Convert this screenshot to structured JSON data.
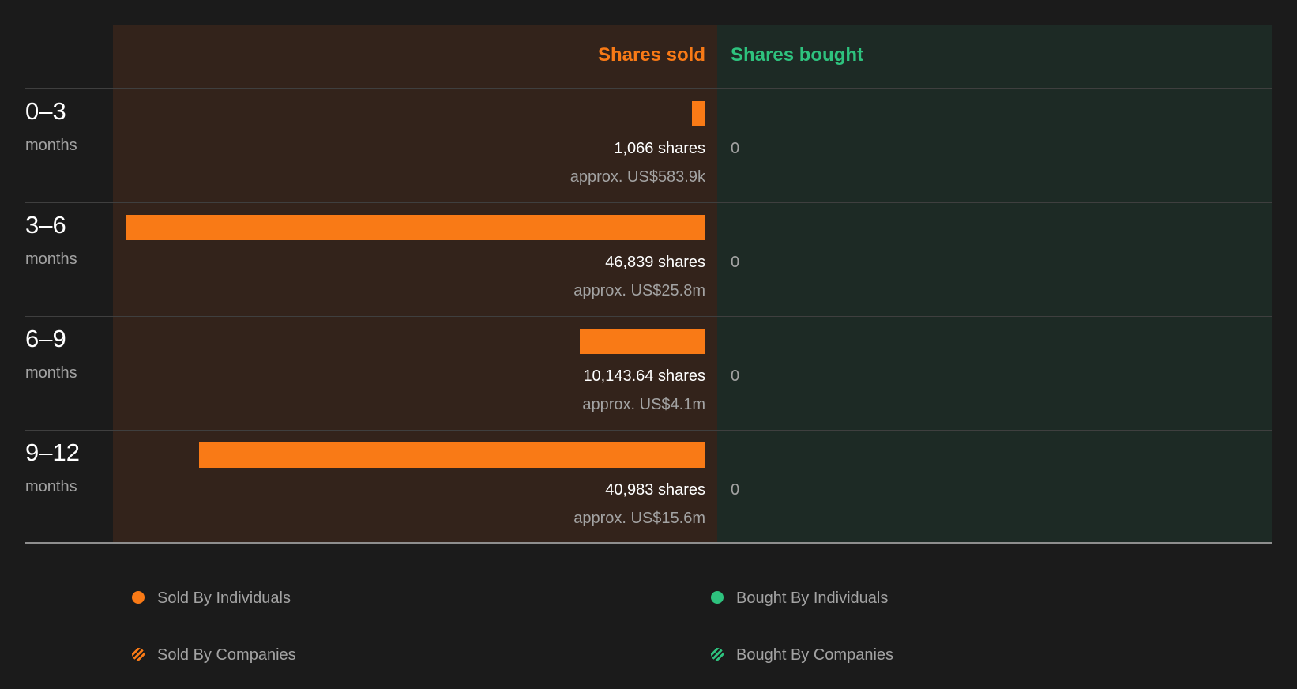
{
  "chart_data": {
    "type": "bar",
    "orientation": "horizontal",
    "headers": {
      "sold": "Shares sold",
      "bought": "Shares bought"
    },
    "rows": [
      {
        "period": "0–3",
        "unit": "months",
        "sold_shares": 1066,
        "sold_label": "1,066 shares",
        "sold_value": "approx. US$583.9k",
        "bought_label": "0"
      },
      {
        "period": "3–6",
        "unit": "months",
        "sold_shares": 46839,
        "sold_label": "46,839 shares",
        "sold_value": "approx. US$25.8m",
        "bought_label": "0"
      },
      {
        "period": "6–9",
        "unit": "months",
        "sold_shares": 10143.64,
        "sold_label": "10,143.64 shares",
        "sold_value": "approx. US$4.1m",
        "bought_label": "0"
      },
      {
        "period": "9–12",
        "unit": "months",
        "sold_shares": 40983,
        "sold_label": "40,983 shares",
        "sold_value": "approx. US$15.6m",
        "bought_label": "0"
      }
    ],
    "legend": [
      {
        "label": "Sold By Individuals",
        "color": "#f97a16",
        "style": "solid"
      },
      {
        "label": "Bought By Individuals",
        "color": "#2ec27e",
        "style": "solid"
      },
      {
        "label": "Sold By Companies",
        "color": "#f97a16",
        "style": "striped"
      },
      {
        "label": "Bought By Companies",
        "color": "#2ec27e",
        "style": "striped"
      }
    ],
    "colors": {
      "sold": "#f97a16",
      "bought": "#2ec27e",
      "sold_panel": "#33231b",
      "bought_panel": "#1d2a25",
      "background": "#1b1b1b"
    }
  }
}
